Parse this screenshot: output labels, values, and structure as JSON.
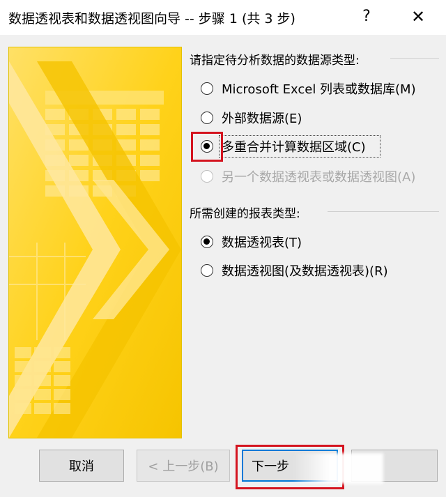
{
  "window": {
    "title": "数据透视表和数据透视图向导 -- 步骤 1 (共 3 步)",
    "help_label": "?",
    "close_label": "✕"
  },
  "source_group": {
    "label": "请指定待分析数据的数据源类型:",
    "options": [
      {
        "label": "Microsoft Excel 列表或数据库(M)",
        "checked": false,
        "disabled": false
      },
      {
        "label": "外部数据源(E)",
        "checked": false,
        "disabled": false
      },
      {
        "label": "多重合并计算数据区域(C)",
        "checked": true,
        "disabled": false
      },
      {
        "label": "另一个数据透视表或数据透视图(A)",
        "checked": false,
        "disabled": true
      }
    ]
  },
  "report_group": {
    "label": "所需创建的报表类型:",
    "options": [
      {
        "label": "数据透视表(T)",
        "checked": true,
        "disabled": false
      },
      {
        "label": "数据透视图(及数据透视表)(R)",
        "checked": false,
        "disabled": false
      }
    ]
  },
  "buttons": {
    "cancel": "取消",
    "back": "< 上一步(B)",
    "next": "下一步"
  },
  "colors": {
    "highlight_red": "#d4141f",
    "illustration_yellow": "#ffd21a"
  }
}
